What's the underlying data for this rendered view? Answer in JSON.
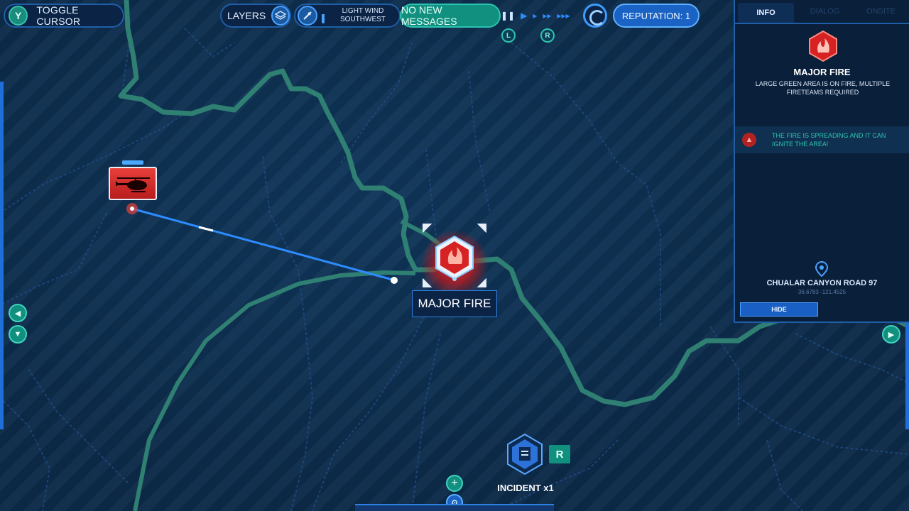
{
  "top_bar": {
    "toggle_cursor": {
      "key": "Y",
      "label": "TOGGLE CURSOR"
    },
    "layers": {
      "label": "LAYERS",
      "icon": "layers-icon"
    },
    "wind": {
      "line1": "LIGHT WIND",
      "line2": "SOUTHWEST",
      "icon": "wind-direction-icon"
    },
    "messages": {
      "label": "NO NEW MESSAGES"
    },
    "speed_controls": {
      "pause": "❚❚",
      "play": "▶",
      "fast": "▸",
      "faster": "▸▸",
      "fastest": "▸▸▸"
    },
    "shoulder_left": "L",
    "shoulder_right": "R",
    "reputation": {
      "label": "REPUTATION: 1"
    }
  },
  "panel": {
    "tabs": [
      "INFO",
      "DIALOG",
      "ONSITE"
    ],
    "active_tab": "INFO",
    "title": "MAJOR FIRE",
    "description": "LARGE GREEN AREA IS ON FIRE, MULTIPLE FIRETEAMS REQUIRED",
    "warning": "THE FIRE IS SPREADING AND IT CAN IGNITE THE AREA!",
    "location_name": "CHUALAR CANYON ROAD 97",
    "coordinates": "36.6783 -121.4525",
    "hide_label": "HIDE"
  },
  "map": {
    "fire_label": "MAJOR FIRE",
    "incident_label": "INCIDENT x1",
    "incident_key": "R"
  },
  "colors": {
    "fire_red": "#e8403a",
    "teal": "#12907f",
    "route_blue": "#2d8cff",
    "river": "#2f7f73"
  }
}
